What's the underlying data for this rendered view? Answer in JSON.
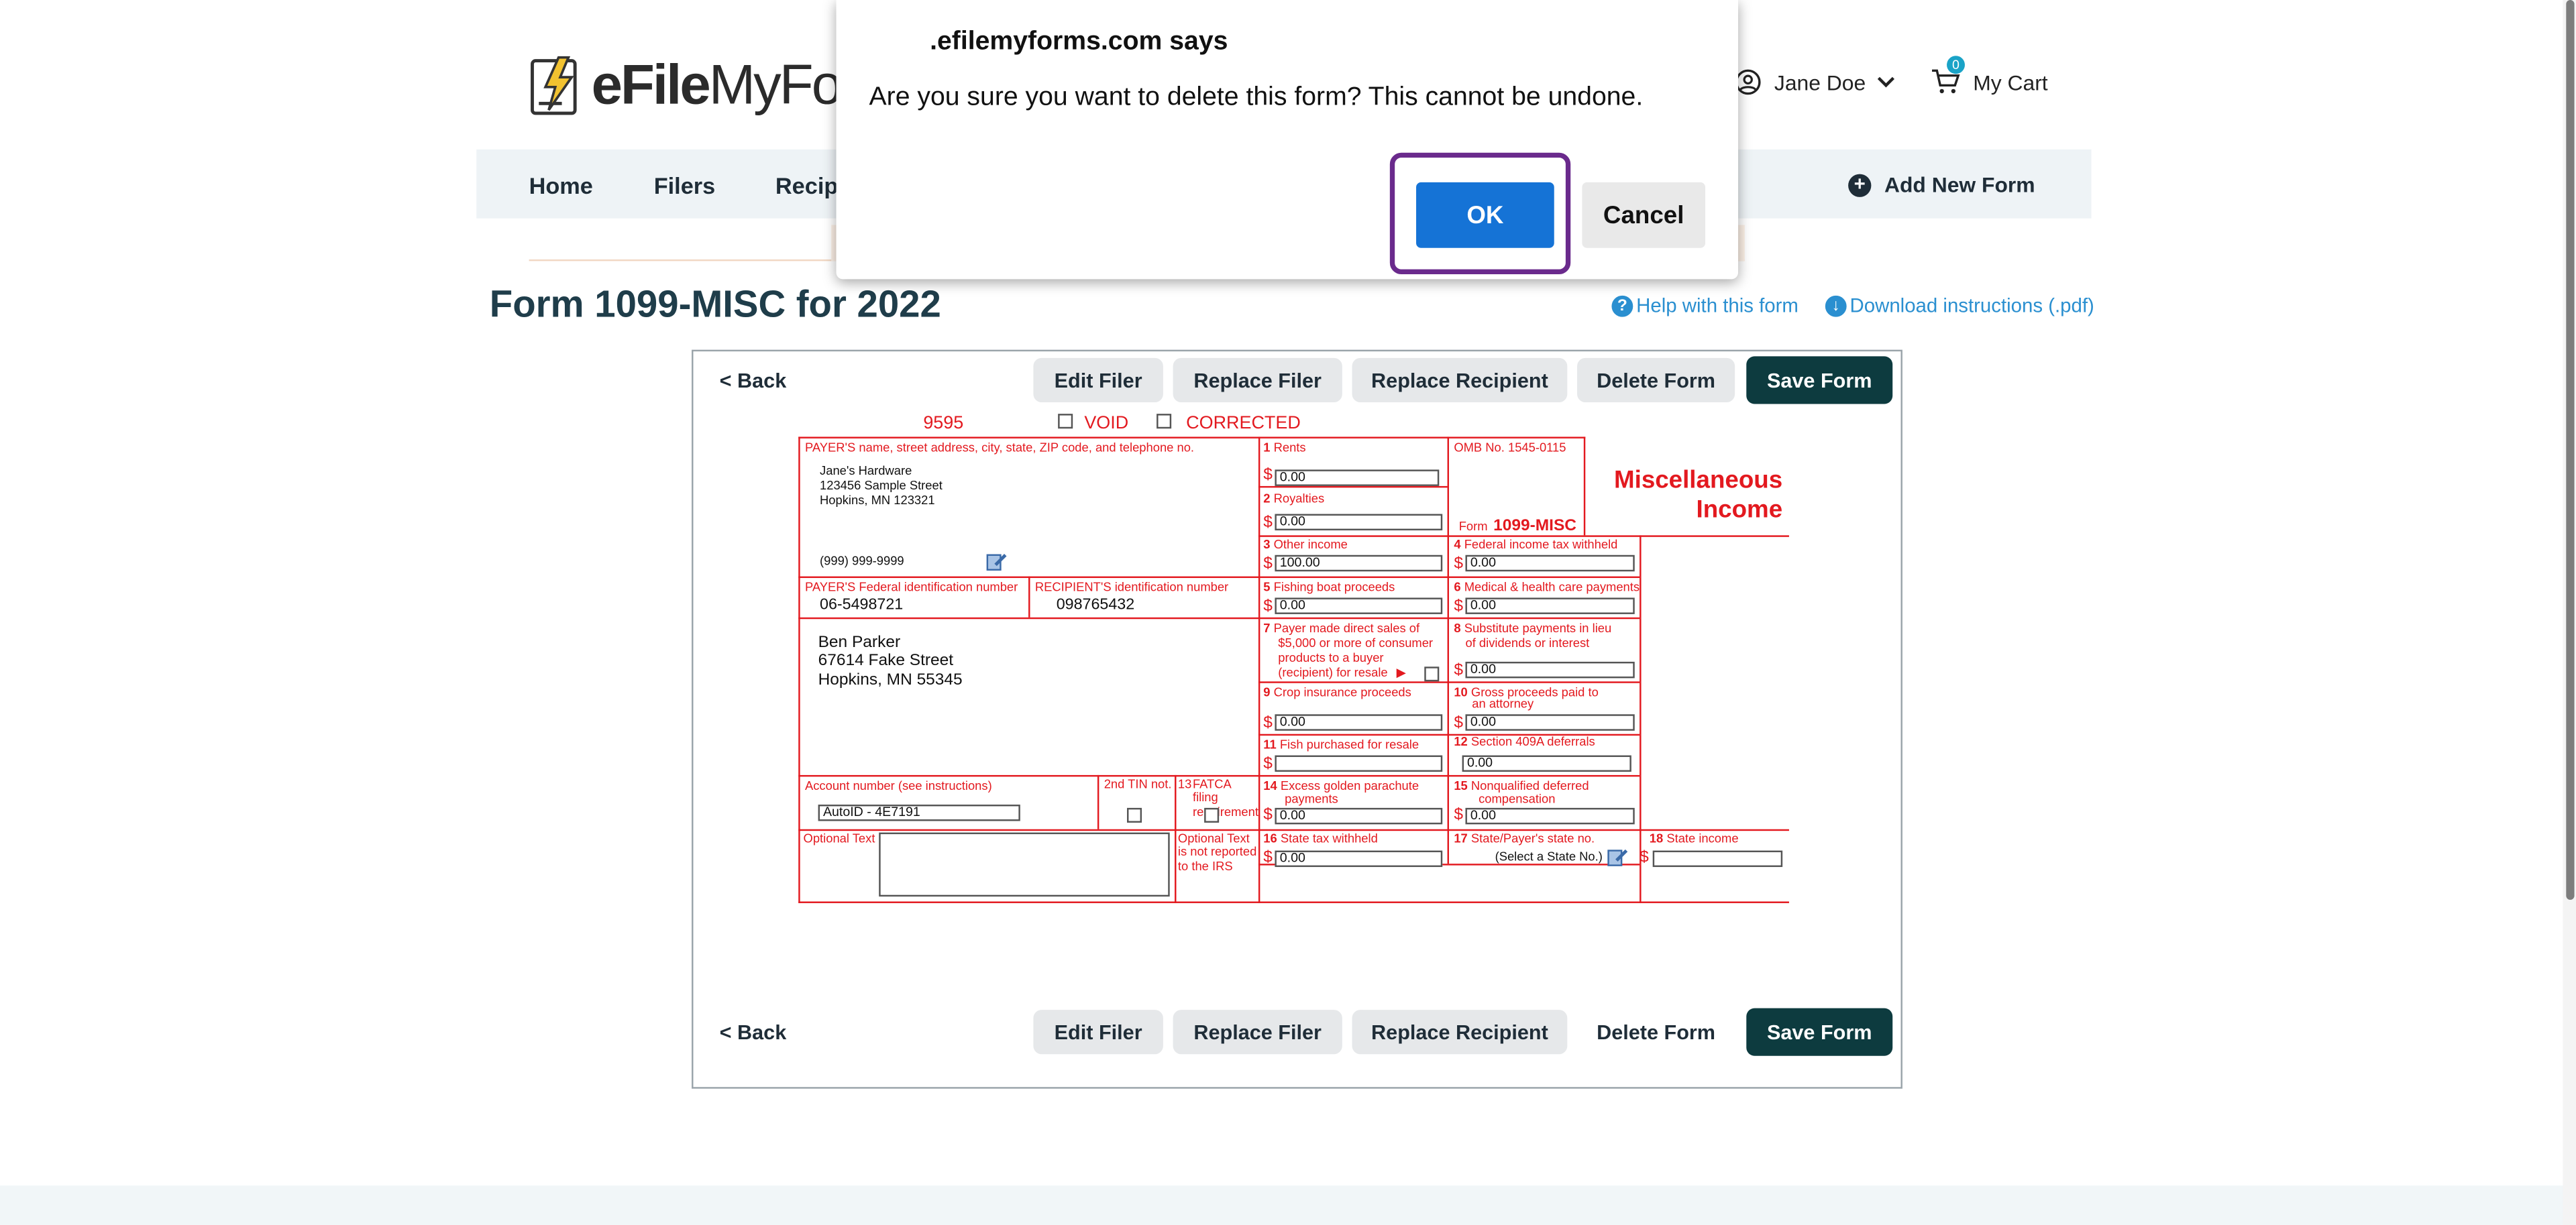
{
  "header": {
    "logo_bold": "eFile",
    "logo_rest": "MyFor",
    "user_name": "Jane Doe",
    "cart_count": "0",
    "cart_label": "My Cart"
  },
  "nav": {
    "items": [
      "Home",
      "Filers",
      "Recipi"
    ],
    "add_form": "Add New Form"
  },
  "page": {
    "title": "Form 1099-MISC for 2022",
    "help_link": "Help with this form",
    "download_link": "Download instructions (.pdf)"
  },
  "toolbar": {
    "back": "< Back",
    "edit_filer": "Edit Filer",
    "replace_filer": "Replace Filer",
    "replace_recipient": "Replace Recipient",
    "delete_form": "Delete Form",
    "save_form": "Save Form"
  },
  "form": {
    "code": "9595",
    "void": "VOID",
    "corrected": "CORRECTED",
    "payer_label": "PAYER'S name, street address, city, state, ZIP code, and telephone no.",
    "payer_name": "Jane's Hardware",
    "payer_street": "123456 Sample Street",
    "payer_city": "Hopkins, MN 123321",
    "payer_phone": "(999) 999-9999",
    "payer_tin_label": "PAYER'S Federal identification number",
    "payer_tin": "06-5498721",
    "recipient_tin_label": "RECIPIENT'S identification number",
    "recipient_tin": "098765432",
    "recipient_name": "Ben Parker",
    "recipient_street": "67614 Fake Street",
    "recipient_city": "Hopkins, MN 55345",
    "account_label": "Account number (see instructions)",
    "account_value": "AutoID - 4E7191",
    "second_tin": "2nd TIN not.",
    "fatca_num": "13",
    "fatca": "FATCA filing requirement",
    "optional_text": "Optional Text",
    "optional_note": "Optional Text is not reported to the IRS",
    "omb": "OMB No. 1545-0115",
    "form_label": "Form",
    "form_name": "1099-MISC",
    "form_title_1": "Miscellaneous",
    "form_title_2": "Income",
    "dollar": "$",
    "b1_num": "1",
    "b1": "Rents",
    "b1_val": "0.00",
    "b2_num": "2",
    "b2": "Royalties",
    "b2_val": "0.00",
    "b3_num": "3",
    "b3": "Other income",
    "b3_val": "100.00",
    "b4_num": "4",
    "b4": "Federal income tax withheld",
    "b4_val": "0.00",
    "b5_num": "5",
    "b5": "Fishing boat proceeds",
    "b5_val": "0.00",
    "b6_num": "6",
    "b6": "Medical & health care payments",
    "b6_val": "0.00",
    "b7_num": "7",
    "b7_l1": "Payer made direct sales of",
    "b7_l2": "$5,000 or more of consumer",
    "b7_l3": "products to a buyer",
    "b7_l4": "(recipient) for resale",
    "b8_num": "8",
    "b8_l1": "Substitute payments in lieu",
    "b8_l2": "of dividends or interest",
    "b8_val": "0.00",
    "b9_num": "9",
    "b9": "Crop insurance proceeds",
    "b9_val": "0.00",
    "b10_num": "10",
    "b10_l1": "Gross proceeds paid to",
    "b10_l2": "an attorney",
    "b10_val": "0.00",
    "b11_num": "11",
    "b11": "Fish purchased for resale",
    "b12_num": "12",
    "b12": "Section 409A deferrals",
    "b12_val": "0.00",
    "b14_num": "14",
    "b14_l1": "Excess golden parachute",
    "b14_l2": "payments",
    "b14_val": "0.00",
    "b15_num": "15",
    "b15_l1": "Nonqualified deferred",
    "b15_l2": "compensation",
    "b15_val": "0.00",
    "b16_num": "16",
    "b16": "State tax withheld",
    "b16_val": "0.00",
    "b17_num": "17",
    "b17": "State/Payer's state no.",
    "b17_select": "(Select a State No.)",
    "b18_num": "18",
    "b18": "State income"
  },
  "dialog": {
    "title": ".efilemyforms.com says",
    "message": "Are you sure you want to delete this form?  This cannot be undone.",
    "ok": "OK",
    "cancel": "Cancel"
  },
  "colors": {
    "form_red": "#e3191f",
    "save_dark": "#0d3b3f",
    "ok_blue": "#1573d6",
    "focus_ring": "#6a2a8c",
    "link": "#2a8fd0"
  }
}
